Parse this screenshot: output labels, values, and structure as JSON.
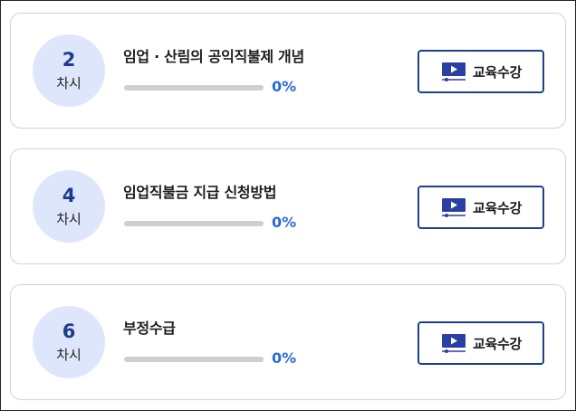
{
  "lessons": [
    {
      "number": "2",
      "unit": "차시",
      "title": "임업 · 산림의 공익직불제 개념",
      "progress_percent": 0,
      "progress_label": "0%",
      "button_label": "교육수강",
      "button_icon": "video-play-icon"
    },
    {
      "number": "4",
      "unit": "차시",
      "title": "임업직불금 지급 신청방법",
      "progress_percent": 0,
      "progress_label": "0%",
      "button_label": "교육수강",
      "button_icon": "video-play-icon"
    },
    {
      "number": "6",
      "unit": "차시",
      "title": "부정수급",
      "progress_percent": 0,
      "progress_label": "0%",
      "button_label": "교육수강",
      "button_icon": "video-play-icon"
    }
  ],
  "colors": {
    "badge_bg": "#dde6fb",
    "badge_number": "#1d3b8f",
    "progress_text": "#2a6ad8",
    "button_border": "#1f3f8c",
    "icon": "#2b3fa0"
  }
}
